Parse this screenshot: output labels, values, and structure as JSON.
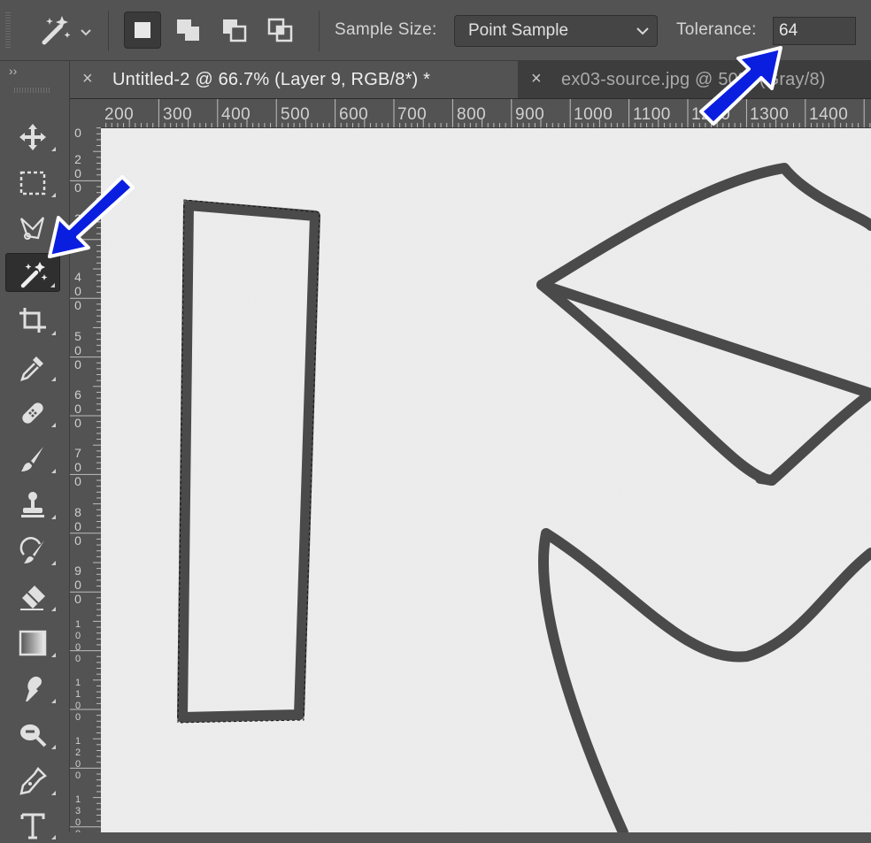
{
  "options_bar": {
    "tool_preset_icon": "magic-wand-icon",
    "selection_modes": [
      "new-selection-icon",
      "add-to-selection-icon",
      "subtract-from-selection-icon",
      "intersect-selection-icon"
    ],
    "sample_size_label": "Sample Size:",
    "sample_size_value": "Point Sample",
    "tolerance_label": "Tolerance:",
    "tolerance_value": "64"
  },
  "tools_panel": {
    "collapse_glyph": "››",
    "tools": [
      "move-tool-icon",
      "marquee-tool-icon",
      "lasso-tool-icon",
      "magic-wand-tool-icon",
      "crop-tool-icon",
      "eyedropper-tool-icon",
      "healing-brush-tool-icon",
      "brush-tool-icon",
      "clone-stamp-tool-icon",
      "history-brush-tool-icon",
      "eraser-tool-icon",
      "gradient-tool-icon",
      "smudge-tool-icon",
      "dodge-tool-icon",
      "pen-tool-icon",
      "type-tool-icon"
    ],
    "active_tool": "magic-wand-tool-icon"
  },
  "tabs": [
    {
      "title": "Untitled-2 @ 66.7% (Layer 9, RGB/8*) *",
      "close": "×"
    },
    {
      "title": "ex03-source.jpg @ 50% (Gray/8)",
      "close": "×"
    }
  ],
  "ruler_h": [
    "200",
    "300",
    "400",
    "500",
    "600",
    "700",
    "800",
    "900",
    "1000",
    "1100",
    "1200",
    "1300",
    "1400"
  ],
  "ruler_v": [
    "0",
    "200",
    "300",
    "400",
    "500",
    "600",
    "700",
    "800",
    "900",
    "1000",
    "1100",
    "1200",
    "1300"
  ],
  "colors": {
    "panel": "#535353",
    "canvas": "#ededed",
    "stroke": "#484848",
    "annotation_arrow": "#0a1ee0"
  }
}
